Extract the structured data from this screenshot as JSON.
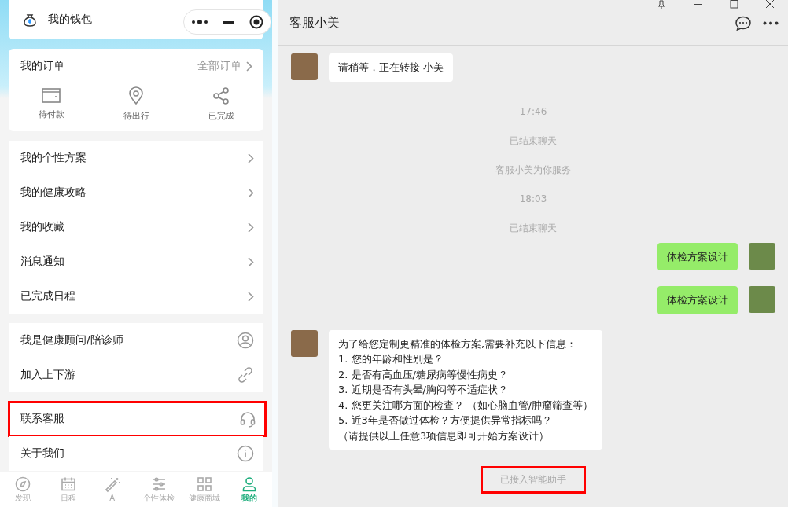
{
  "mini_program": {
    "wallet": {
      "label": "我的钱包"
    },
    "orders": {
      "title": "我的订单",
      "all_link": "全部订单",
      "items": [
        {
          "kind": "wallet",
          "label": "待付款"
        },
        {
          "kind": "pin",
          "label": "待出行"
        },
        {
          "kind": "share",
          "label": "已完成"
        }
      ]
    },
    "menu_groups": [
      {
        "items": [
          {
            "label": "我的个性方案",
            "kind": "chevron",
            "highlighted": false
          },
          {
            "label": "我的健康攻略",
            "kind": "chevron",
            "highlighted": false
          },
          {
            "label": "我的收藏",
            "kind": "chevron",
            "highlighted": false
          },
          {
            "label": "消息通知",
            "kind": "chevron",
            "highlighted": false
          },
          {
            "label": "已完成日程",
            "kind": "chevron",
            "highlighted": false
          }
        ]
      },
      {
        "items": [
          {
            "label": "我是健康顾问/陪诊师",
            "kind": "user",
            "highlighted": false
          },
          {
            "label": "加入上下游",
            "kind": "link",
            "highlighted": false
          }
        ]
      },
      {
        "items": [
          {
            "label": "联系客服",
            "kind": "headset",
            "highlighted": true
          },
          {
            "label": "关于我们",
            "kind": "info",
            "highlighted": false
          }
        ]
      }
    ],
    "tab_bar": [
      {
        "kind": "compass",
        "label": "发现",
        "selected": false
      },
      {
        "kind": "calendar",
        "label": "日程",
        "selected": false
      },
      {
        "kind": "wand",
        "label": "AI",
        "selected": false
      },
      {
        "kind": "sliders",
        "label": "个性体检",
        "selected": false
      },
      {
        "kind": "grid",
        "label": "健康商城",
        "selected": false
      },
      {
        "kind": "user",
        "label": "我的",
        "selected": true
      }
    ]
  },
  "chat": {
    "title": "客服小美",
    "messages": [
      {
        "kind": "incoming",
        "text": "请稍等，正在转接 小美"
      },
      {
        "kind": "time",
        "text": "17:46"
      },
      {
        "kind": "system",
        "text": "已结束聊天",
        "highlighted": false
      },
      {
        "kind": "system",
        "text": "客服小美为你服务",
        "highlighted": false
      },
      {
        "kind": "time",
        "text": "18:03"
      },
      {
        "kind": "system",
        "text": "已结束聊天",
        "highlighted": false
      },
      {
        "kind": "outgoing",
        "text": "体检方案设计"
      },
      {
        "kind": "outgoing",
        "text": "体检方案设计"
      },
      {
        "kind": "incoming",
        "lines": [
          "为了给您定制更精准的体检方案,需要补充以下信息：",
          "1. 您的年龄和性别是？",
          "2. 是否有高血压/糖尿病等慢性病史？",
          "3. 近期是否有头晕/胸闷等不适症状？",
          "4. 您更关注哪方面的检查？ （如心脑血管/肿瘤筛查等）",
          "5. 近3年是否做过体检？方便提供异常指标吗？",
          "（请提供以上任意3项信息即可开始方案设计）"
        ]
      },
      {
        "kind": "system",
        "text": "已接入智能助手",
        "highlighted": true
      }
    ]
  }
}
